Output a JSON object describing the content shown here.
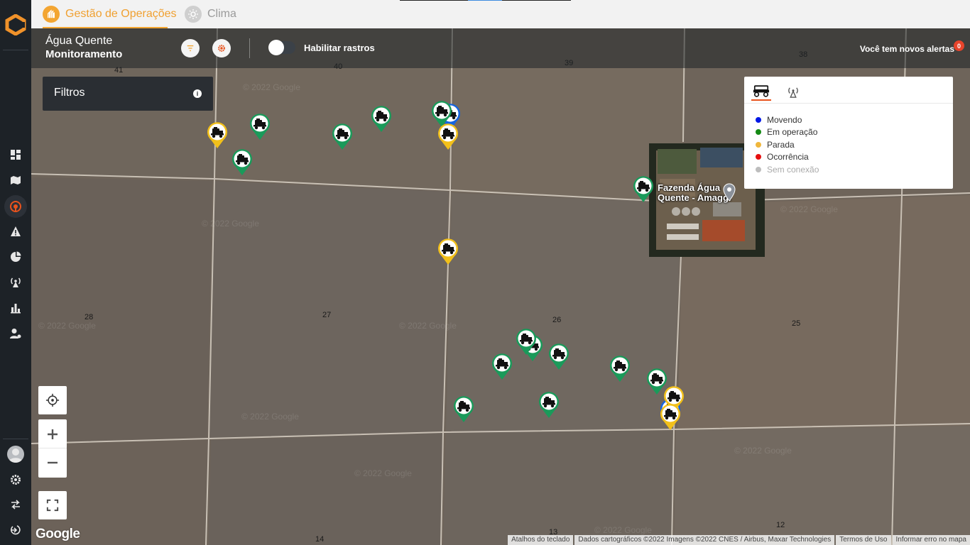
{
  "topbar": {
    "tabs": [
      {
        "label": "Gestão de Operações",
        "active": true
      },
      {
        "label": "Clima",
        "active": false
      }
    ]
  },
  "header": {
    "site_name": "Água Quente",
    "view_name": "Monitoramento",
    "toggle_label": "Habilitar rastros",
    "toggle_on": false,
    "alerts_text": "Você tem novos alertas",
    "alerts_count": "0"
  },
  "filters": {
    "label": "Filtros"
  },
  "legend": {
    "items": [
      {
        "label": "Movendo",
        "color": "#0018e6"
      },
      {
        "label": "Em operação",
        "color": "#158a15"
      },
      {
        "label": "Parada",
        "color": "#f0b73c"
      },
      {
        "label": "Ocorrência",
        "color": "#e60f0f"
      },
      {
        "label": "Sem conexão",
        "color": "#bdbdbd"
      }
    ]
  },
  "map": {
    "place_label_line1": "Fazenda Água",
    "place_label_line2": "Quente - Amaggi",
    "google_logo": "Google",
    "field_numbers": [
      "41",
      "40",
      "39",
      "38",
      "28",
      "27",
      "26",
      "25",
      "14",
      "13",
      "12"
    ],
    "attribution": [
      "Atalhos do teclado",
      "Dados cartográficos ©2022 Imagens ©2022 CNES / Airbus, Maxar Technologies",
      "Termos de Uso",
      "Informar erro no mapa"
    ],
    "watermark": "© 2022 Google"
  },
  "colors": {
    "accent": "#f3a531",
    "brand": "#e8531d",
    "operating": "#1a9a5a",
    "stopped": "#f2c01a",
    "moving": "#1565e0"
  }
}
